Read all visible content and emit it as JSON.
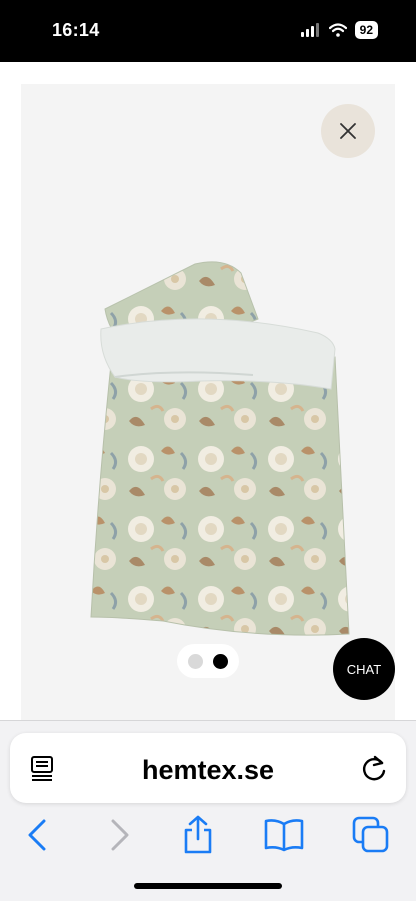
{
  "status_bar": {
    "time": "16:14",
    "battery": "92"
  },
  "gallery": {
    "image_alt": "Floral duvet cover and pillowcase",
    "slides": 2,
    "active_slide": 2
  },
  "chat": {
    "label": "CHAT"
  },
  "browser": {
    "url": "hemtex.se"
  },
  "colors": {
    "accent": "#1a7cf5",
    "close_bg": "#e9e3da"
  },
  "icons": [
    "reader-icon",
    "reload-icon",
    "back-icon",
    "forward-icon",
    "share-icon",
    "bookmarks-icon",
    "tabs-icon",
    "close-icon"
  ]
}
